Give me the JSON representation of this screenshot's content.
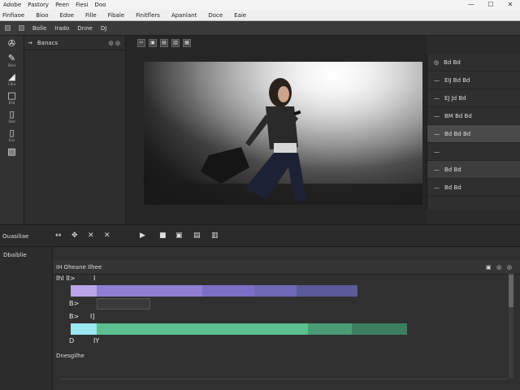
{
  "titlebar": {
    "items": [
      "Adobe",
      "Pastory",
      "Peen",
      "Fiesi",
      "Doo"
    ],
    "controls": [
      "—",
      "☐",
      "✕"
    ]
  },
  "menubar": {
    "items": [
      "Finfiaoe",
      "Bioo",
      "Edoe",
      "Fille",
      "Fibale",
      "Finitflers",
      "Apanlant",
      "Doce",
      "Eaie"
    ]
  },
  "toolbar": {
    "items": [
      "Bolle",
      "Irado",
      "Dnne",
      "DJ"
    ]
  },
  "left_tools": [
    {
      "icon": "✇",
      "label": ""
    },
    {
      "icon": "✎",
      "label": "Blnd"
    },
    {
      "icon": "◢",
      "label": "Cdre"
    },
    {
      "icon": "□",
      "label": "Elld"
    },
    {
      "icon": "▯",
      "label": "Dod"
    },
    {
      "icon": "▯",
      "label": "Eoe"
    },
    {
      "icon": "▧",
      "label": ""
    }
  ],
  "browser": {
    "header_label": "Banacs"
  },
  "viewer": {
    "tool_icons": [
      "✂",
      "▣",
      "▤",
      "▥",
      "▦"
    ]
  },
  "properties": {
    "rows": [
      {
        "label": "Bd Bd",
        "selected": false
      },
      {
        "label": "EIJ Bd Bd",
        "selected": false
      },
      {
        "label": "EJ Jd Bd",
        "selected": false
      },
      {
        "label": "BM Bd Bd",
        "selected": false
      },
      {
        "label": "Bd Bd",
        "selected": false
      },
      {
        "label": "Bd Bd Bd",
        "selected": true
      },
      {
        "label": "",
        "selected": false
      },
      {
        "label": "Bd Bd",
        "selected": false
      },
      {
        "label": "Bd Bd",
        "selected": false
      }
    ]
  },
  "controls_strip": {
    "label": "Ouasiliae",
    "icons": [
      "↔",
      "✥",
      "✕",
      "✕"
    ],
    "viewer_buttons": [
      "▶",
      "■",
      "▣",
      "▤",
      "▥"
    ]
  },
  "timeline": {
    "left_label": "Dbaiblie",
    "header": "IH Oheane Ilhee",
    "tracks": [
      {
        "label": "Ihl II>",
        "marker": "I"
      },
      {
        "label": "B>",
        "marker": "I"
      },
      {
        "label": "B>",
        "marker": "I]"
      },
      {
        "label": "D",
        "marker": "IY"
      }
    ],
    "status": "Dnesgilhe"
  },
  "colors": {
    "clip_purple_light": "#b9a6e8",
    "clip_purple": "#8f7fd3",
    "clip_purple_dark": "#6b64a8",
    "clip_cyan": "#9be7f2",
    "clip_green": "#5cbf8f",
    "clip_green_dark": "#3c7f60"
  }
}
